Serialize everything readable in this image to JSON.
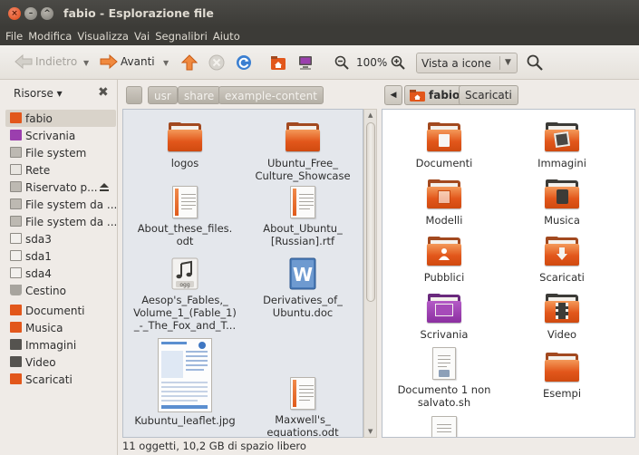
{
  "window": {
    "title": "fabio - Esplorazione file"
  },
  "menu": [
    "File",
    "Modifica",
    "Visualizza",
    "Vai",
    "Segnalibri",
    "Aiuto"
  ],
  "toolbar": {
    "back_label": "Indietro",
    "forward_label": "Avanti",
    "zoom_level": "100%",
    "view_mode": "Vista a icone"
  },
  "sidebar": {
    "header": "Risorse ▾",
    "items": [
      {
        "label": "fabio",
        "icon": "home-folder-icon",
        "selected": true
      },
      {
        "label": "Scrivania",
        "icon": "desktop-icon"
      },
      {
        "label": "File system",
        "icon": "drive-icon"
      },
      {
        "label": "Rete",
        "icon": "network-icon"
      },
      {
        "label": "Riservato p...",
        "icon": "drive-icon",
        "eject": true
      },
      {
        "label": "File system da ...",
        "icon": "drive-icon"
      },
      {
        "label": "File system da ...",
        "icon": "drive-icon"
      },
      {
        "label": "sda3",
        "icon": "drive-icon"
      },
      {
        "label": "sda1",
        "icon": "drive-icon"
      },
      {
        "label": "sda4",
        "icon": "drive-icon"
      },
      {
        "label": "Cestino",
        "icon": "trash-icon"
      },
      {
        "label": "Documenti",
        "icon": "documents-folder-icon"
      },
      {
        "label": "Musica",
        "icon": "music-folder-icon"
      },
      {
        "label": "Immagini",
        "icon": "pictures-folder-icon"
      },
      {
        "label": "Video",
        "icon": "video-folder-icon"
      },
      {
        "label": "Scaricati",
        "icon": "downloads-folder-icon"
      }
    ]
  },
  "left_path": [
    "usr",
    "share",
    "example-content"
  ],
  "left_files": [
    {
      "name": "logos",
      "type": "folder"
    },
    {
      "name": "Ubuntu_Free_\nCulture_Showcase",
      "type": "folder"
    },
    {
      "name": "About_these_files.\nodt",
      "type": "document"
    },
    {
      "name": "About_Ubuntu_\n[Russian].rtf",
      "type": "document"
    },
    {
      "name": "Aesop's_Fables,_\nVolume_1_(Fable_1)\n_-_The_Fox_and_T...",
      "type": "audio"
    },
    {
      "name": "Derivatives_of_\nUbuntu.doc",
      "type": "word"
    },
    {
      "name": "Kubuntu_leaflet.jpg",
      "type": "image"
    },
    {
      "name": "Maxwell's_\nequations.odt",
      "type": "document"
    }
  ],
  "right_path": [
    "fabio",
    "Scaricati"
  ],
  "right_files": [
    {
      "name": "Documenti",
      "type": "folder-documents"
    },
    {
      "name": "Immagini",
      "type": "folder-pictures"
    },
    {
      "name": "Modelli",
      "type": "folder-templates"
    },
    {
      "name": "Musica",
      "type": "folder-music"
    },
    {
      "name": "Pubblici",
      "type": "folder-public"
    },
    {
      "name": "Scaricati",
      "type": "folder-downloads"
    },
    {
      "name": "Scrivania",
      "type": "folder-desktop"
    },
    {
      "name": "Video",
      "type": "folder-video"
    },
    {
      "name": "Documento 1 non\nsalvato.sh",
      "type": "document"
    },
    {
      "name": "Esempi",
      "type": "folder"
    }
  ],
  "status": "11 oggetti, 10,2 GB di spazio libero",
  "colors": {
    "accent": "#e2571b",
    "titlebar": "#3c3b37",
    "pane_bg": "#e4e7ec"
  }
}
